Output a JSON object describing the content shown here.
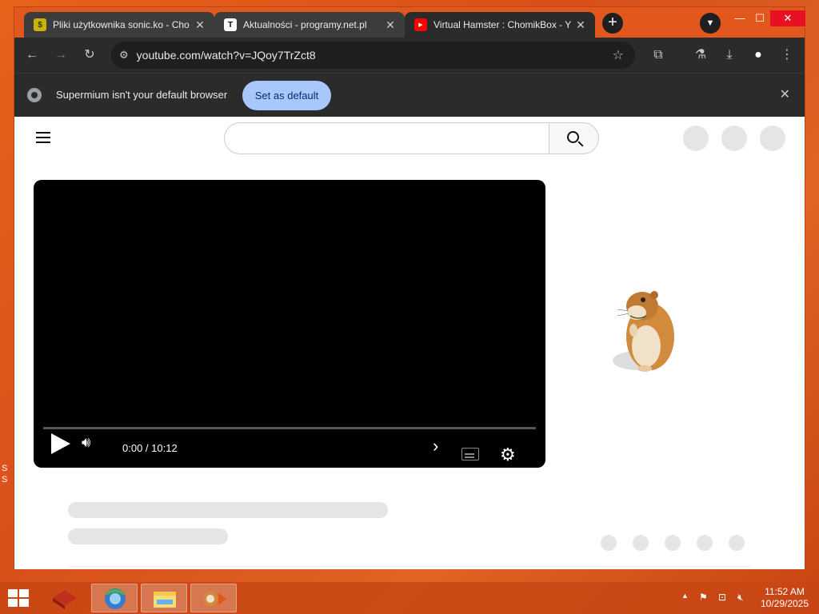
{
  "desktop": {
    "glyphs": [
      "S",
      "S"
    ]
  },
  "browser": {
    "tabs": [
      {
        "title": "Pliki użytkownika sonic.ko - Cho",
        "favicon_color": "#c8b400",
        "favicon_glyph": "$",
        "active": false
      },
      {
        "title": "Aktualności - programy.net.pl",
        "favicon_color": "#ffffff",
        "favicon_glyph": "T",
        "active": false
      },
      {
        "title": "Virtual Hamster : ChomikBox - Y",
        "favicon_color": "#ff0000",
        "favicon_glyph": "▶",
        "active": true
      }
    ],
    "address_bar": {
      "url": "youtube.com/watch?v=JQoy7TrZct8"
    },
    "infobar": {
      "message": "Supermium isn't your default browser",
      "button": "Set as default"
    }
  },
  "youtube": {
    "player": {
      "time": "0:00 / 10:12",
      "progress": 0
    }
  },
  "taskbar": {
    "clock_time": "11:52 AM",
    "clock_date": "10/29/2025"
  },
  "colors": {
    "desktop": "#e2581c",
    "browser_chrome": "#2b2b2b",
    "set_default_button": "#a8c7fa",
    "player_bg": "#000000"
  }
}
